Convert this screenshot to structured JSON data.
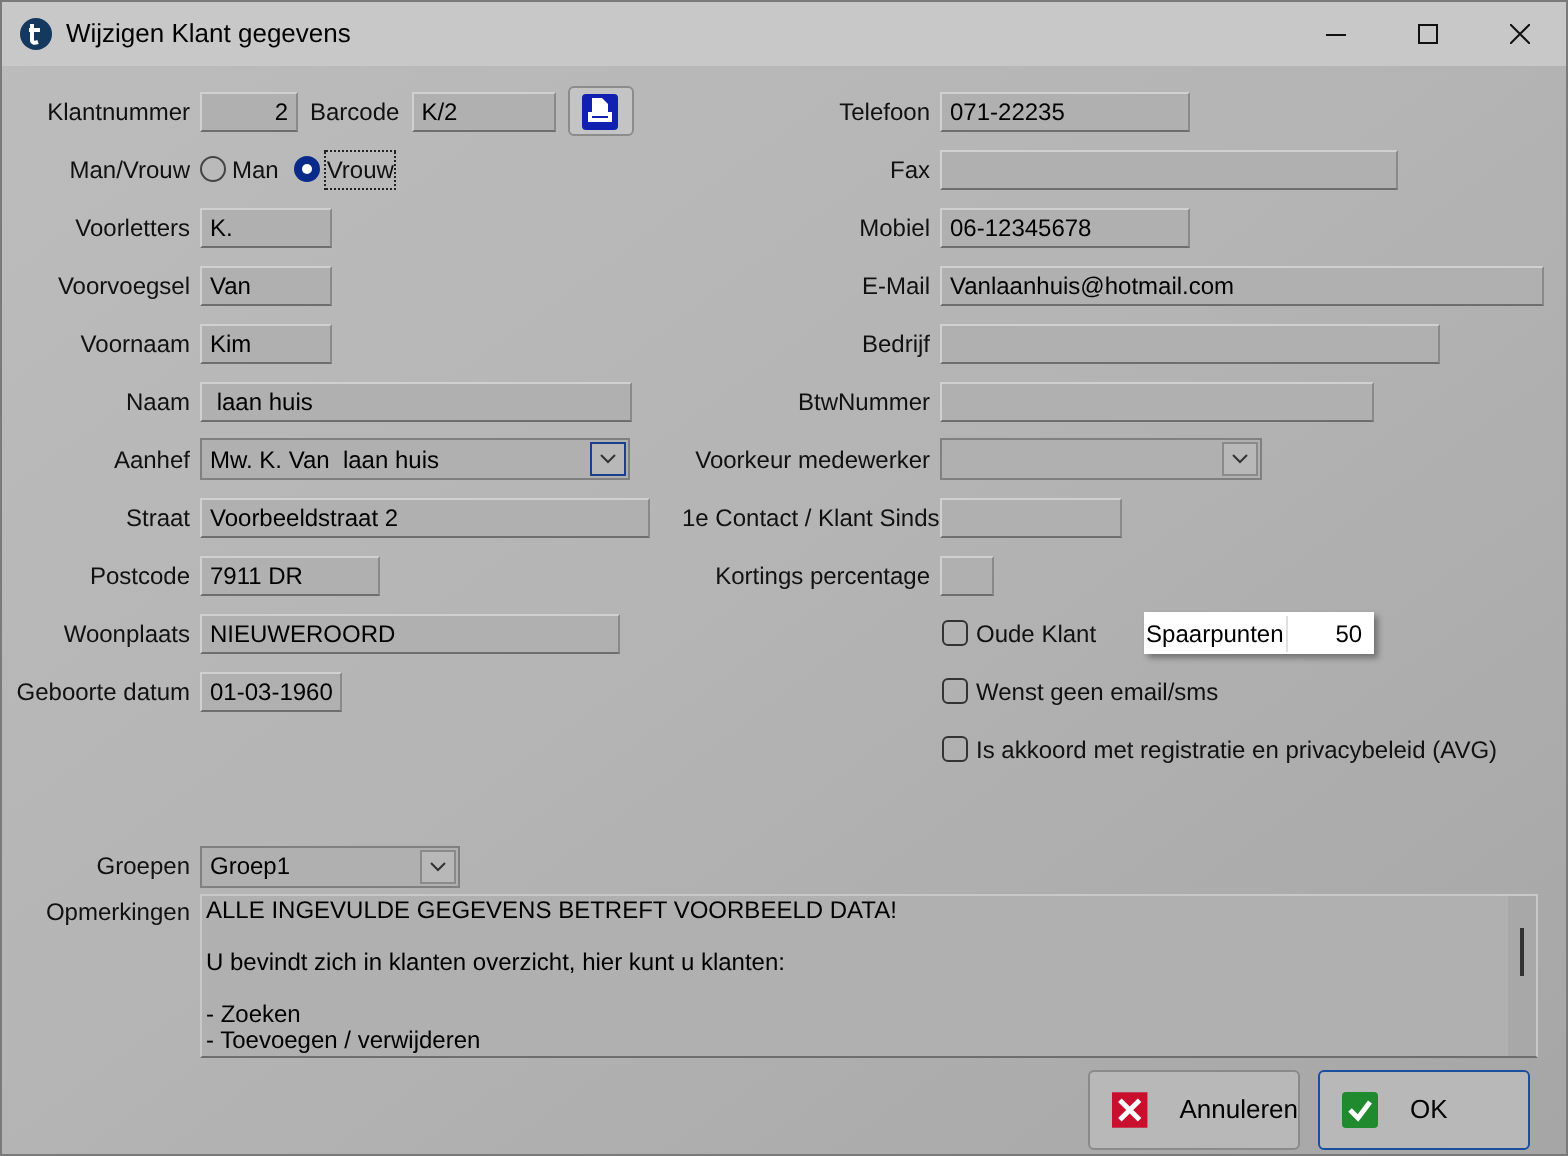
{
  "window": {
    "title": "Wijzigen Klant gegevens"
  },
  "left_fields": [
    {
      "kind": "number_barcode",
      "label": "Klantnummer",
      "value": "2",
      "barcode_label": "Barcode",
      "barcode_value": "K/2"
    },
    {
      "kind": "radio",
      "label": "Man/Vrouw",
      "options": [
        {
          "label": "Man",
          "selected": false
        },
        {
          "label": "Vrouw",
          "selected": true
        }
      ]
    },
    {
      "kind": "text",
      "label": "Voorletters",
      "value": "K."
    },
    {
      "kind": "text",
      "label": "Voorvoegsel",
      "value": "Van"
    },
    {
      "kind": "text",
      "label": "Voornaam",
      "value": "Kim"
    },
    {
      "kind": "text",
      "label": "Naam",
      "value": " laan huis"
    },
    {
      "kind": "select",
      "label": "Aanhef",
      "value": "Mw. K. Van  laan huis"
    },
    {
      "kind": "text",
      "label": "Straat",
      "value": "Voorbeeldstraat 2"
    },
    {
      "kind": "text",
      "label": "Postcode",
      "value": "7911 DR"
    },
    {
      "kind": "text",
      "label": "Woonplaats",
      "value": "NIEUWEROORD"
    },
    {
      "kind": "text",
      "label": "Geboorte datum",
      "value": "01-03-1960"
    }
  ],
  "right_fields": [
    {
      "kind": "text",
      "label": "Telefoon",
      "value": "071-22235"
    },
    {
      "kind": "text",
      "label": "Fax"
    },
    {
      "kind": "text",
      "label": "Mobiel",
      "value": "06-12345678"
    },
    {
      "kind": "text",
      "label": "E-Mail",
      "value": "Vanlaanhuis@hotmail.com"
    },
    {
      "kind": "text",
      "label": "Bedrijf"
    },
    {
      "kind": "text",
      "label": "BtwNummer"
    },
    {
      "kind": "select",
      "label": "Voorkeur medewerker"
    },
    {
      "kind": "text",
      "label": "1e Contact / Klant Sinds"
    },
    {
      "kind": "text",
      "label": "Kortings percentage"
    }
  ],
  "checkboxes": [
    {
      "label": "Oude Klant",
      "checked": false
    },
    {
      "label": "Wenst geen email/sms",
      "checked": false
    },
    {
      "label": "Is akkoord met registratie en privacybeleid (AVG)",
      "checked": false
    }
  ],
  "spaarpunten": {
    "label": "Spaarpunten",
    "value": "50"
  },
  "groepen": {
    "label": "Groepen",
    "value": "Groep1"
  },
  "opmerkingen": {
    "label": "Opmerkingen",
    "paragraphs": [
      [
        "ALLE INGEVULDE GEGEVENS BETREFT VOORBEELD DATA!"
      ],
      [
        "U bevindt zich in klanten overzicht, hier kunt u klanten:"
      ],
      [
        "- Zoeken",
        "- Toevoegen / verwijderen"
      ]
    ]
  },
  "buttons": [
    {
      "kind": "cancel",
      "label": "Annuleren"
    },
    {
      "kind": "ok",
      "label": "OK"
    }
  ]
}
